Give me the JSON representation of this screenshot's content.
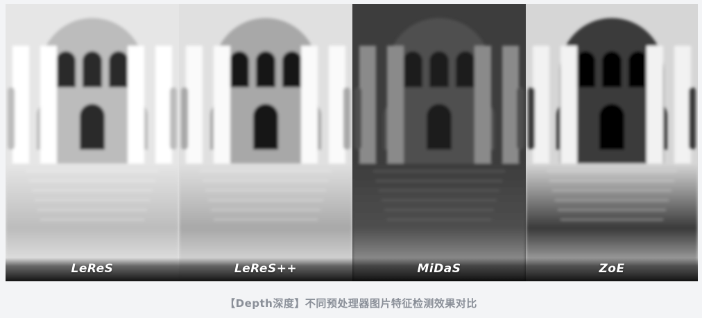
{
  "panels": [
    {
      "id": "leres",
      "label": "LeReS",
      "bg": "#e6e6e6",
      "fg": "#ffffff",
      "dark": "#2a2a2a",
      "mid": "#bcbcbc",
      "floor": "#f4f4f4"
    },
    {
      "id": "leres-pp",
      "label": "LeReS++",
      "bg": "#e0e0e0",
      "fg": "#fafafa",
      "dark": "#141414",
      "mid": "#a8a8a8",
      "floor": "#eeeeee"
    },
    {
      "id": "midas",
      "label": "MiDaS",
      "bg": "#3d3d3d",
      "fg": "#8a8a8a",
      "dark": "#1a1a1a",
      "mid": "#4f4f4f",
      "floor": "#b4b4b4"
    },
    {
      "id": "zoe",
      "label": "ZoE",
      "bg": "#d6d6d6",
      "fg": "#f2f2f2",
      "dark": "#060606",
      "mid": "#3a3a3a",
      "floor": "#dedede"
    }
  ],
  "caption": "【Depth深度】不同预处理器图片特征检测效果对比"
}
